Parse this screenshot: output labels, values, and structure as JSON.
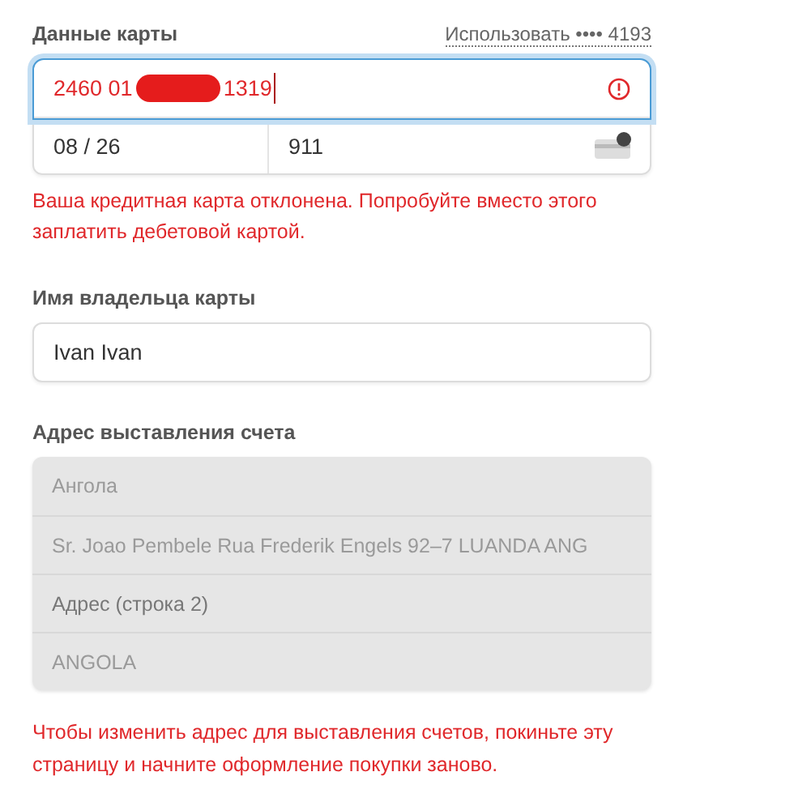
{
  "card_section": {
    "label": "Данные карты",
    "saved_card_link": "Использовать •••• 4193",
    "card_number": {
      "value_start": "2460 01",
      "value_end": "1319",
      "redacted": true,
      "focused": true,
      "invalid": true
    },
    "expiry": {
      "value": "08 / 26"
    },
    "cvc": {
      "value": "911"
    },
    "error": "Ваша кредитная карта отклонена. Попробуйте вместо этого заплатить дебетовой картой."
  },
  "cardholder": {
    "label": "Имя владельца карты",
    "value": "Ivan Ivan"
  },
  "billing_address": {
    "label": "Адрес выставления счета",
    "disabled": true,
    "rows": [
      {
        "kind": "value",
        "text": "Ангола"
      },
      {
        "kind": "value",
        "text": "Sr. Joao Pembele Rua Frederik Engels 92–7 LUANDA ANG"
      },
      {
        "kind": "placeholder",
        "placeholder": "Адрес (строка 2)"
      },
      {
        "kind": "value",
        "text": "ANGOLA"
      }
    ],
    "note": "Чтобы изменить адрес для выставления счетов, покиньте эту страницу и начните оформление покупки заново."
  }
}
